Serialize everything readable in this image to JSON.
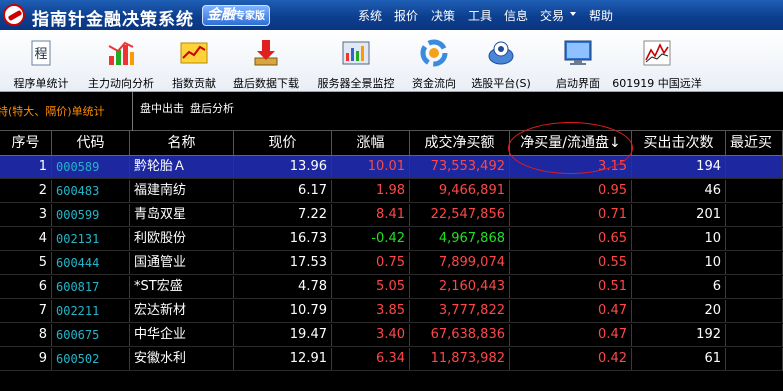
{
  "window": {
    "title": "指南针金融决策系统",
    "brand_badge_main": "金融",
    "brand_badge_sub": "专家版"
  },
  "menu": [
    "系统",
    "报价",
    "决策",
    "工具",
    "信息",
    "交易",
    "帮助"
  ],
  "toolbar": [
    {
      "label": "程序单统计",
      "icon": "document-icon"
    },
    {
      "label": "主力动向分析",
      "icon": "bar-chart-icon"
    },
    {
      "label": "指数贡献",
      "icon": "index-chart-icon"
    },
    {
      "label": "盘后数据下载",
      "icon": "download-icon"
    },
    {
      "label": "服务器全景监控",
      "icon": "server-monitor-icon"
    },
    {
      "label": "资金流向",
      "icon": "recycle-icon"
    },
    {
      "label": "选股平台(S)",
      "icon": "stock-picker-icon"
    },
    {
      "label": "启动界面",
      "icon": "monitor-icon"
    },
    {
      "label": "601919 中国远洋",
      "icon": "line-chart-icon"
    }
  ],
  "sub_bar": {
    "left_label": "特(特大、隔价)单统计",
    "tabs": [
      "盘中出击",
      "盘后分析"
    ]
  },
  "table": {
    "columns": [
      "序号",
      "代码",
      "名称",
      "现价",
      "涨幅",
      "成交净买额",
      "净买量/流通盘↓",
      "买出击次数",
      "最近买"
    ],
    "rows": [
      {
        "no": "1",
        "code": "000589",
        "name": "黔轮胎Ａ",
        "price": "13.96",
        "change": "10.01",
        "net_amount": "73,553,492",
        "ratio": "3.15",
        "count": "194",
        "selected": true
      },
      {
        "no": "2",
        "code": "600483",
        "name": "福建南纺",
        "price": "6.17",
        "change": "1.98",
        "net_amount": "9,466,891",
        "ratio": "0.95",
        "count": "46",
        "selected": false
      },
      {
        "no": "3",
        "code": "000599",
        "name": "青岛双星",
        "price": "7.22",
        "change": "8.41",
        "net_amount": "22,547,856",
        "ratio": "0.71",
        "count": "201",
        "selected": false
      },
      {
        "no": "4",
        "code": "002131",
        "name": "利欧股份",
        "price": "16.73",
        "change": "-0.42",
        "net_amount": "4,967,868",
        "ratio": "0.65",
        "count": "10",
        "selected": false
      },
      {
        "no": "5",
        "code": "600444",
        "name": "国通管业",
        "price": "17.53",
        "change": "0.75",
        "net_amount": "7,899,074",
        "ratio": "0.55",
        "count": "10",
        "selected": false
      },
      {
        "no": "6",
        "code": "600817",
        "name": "*ST宏盛",
        "price": "4.78",
        "change": "5.05",
        "net_amount": "2,160,443",
        "ratio": "0.51",
        "count": "6",
        "selected": false
      },
      {
        "no": "7",
        "code": "002211",
        "name": "宏达新材",
        "price": "10.79",
        "change": "3.85",
        "net_amount": "3,777,822",
        "ratio": "0.47",
        "count": "20",
        "selected": false
      },
      {
        "no": "8",
        "code": "600675",
        "name": "中华企业",
        "price": "19.47",
        "change": "3.40",
        "net_amount": "67,638,836",
        "ratio": "0.47",
        "count": "192",
        "selected": false
      },
      {
        "no": "9",
        "code": "600502",
        "name": "安徽水利",
        "price": "12.91",
        "change": "6.34",
        "net_amount": "11,873,982",
        "ratio": "0.42",
        "count": "61",
        "selected": false
      }
    ]
  },
  "colors": {
    "titlebar": "#0d3f8f",
    "selected_row": "#1c27a0",
    "up": "#ff4747",
    "down": "#22e022",
    "code": "#23b5c7",
    "annotation": "#e21b1b"
  }
}
